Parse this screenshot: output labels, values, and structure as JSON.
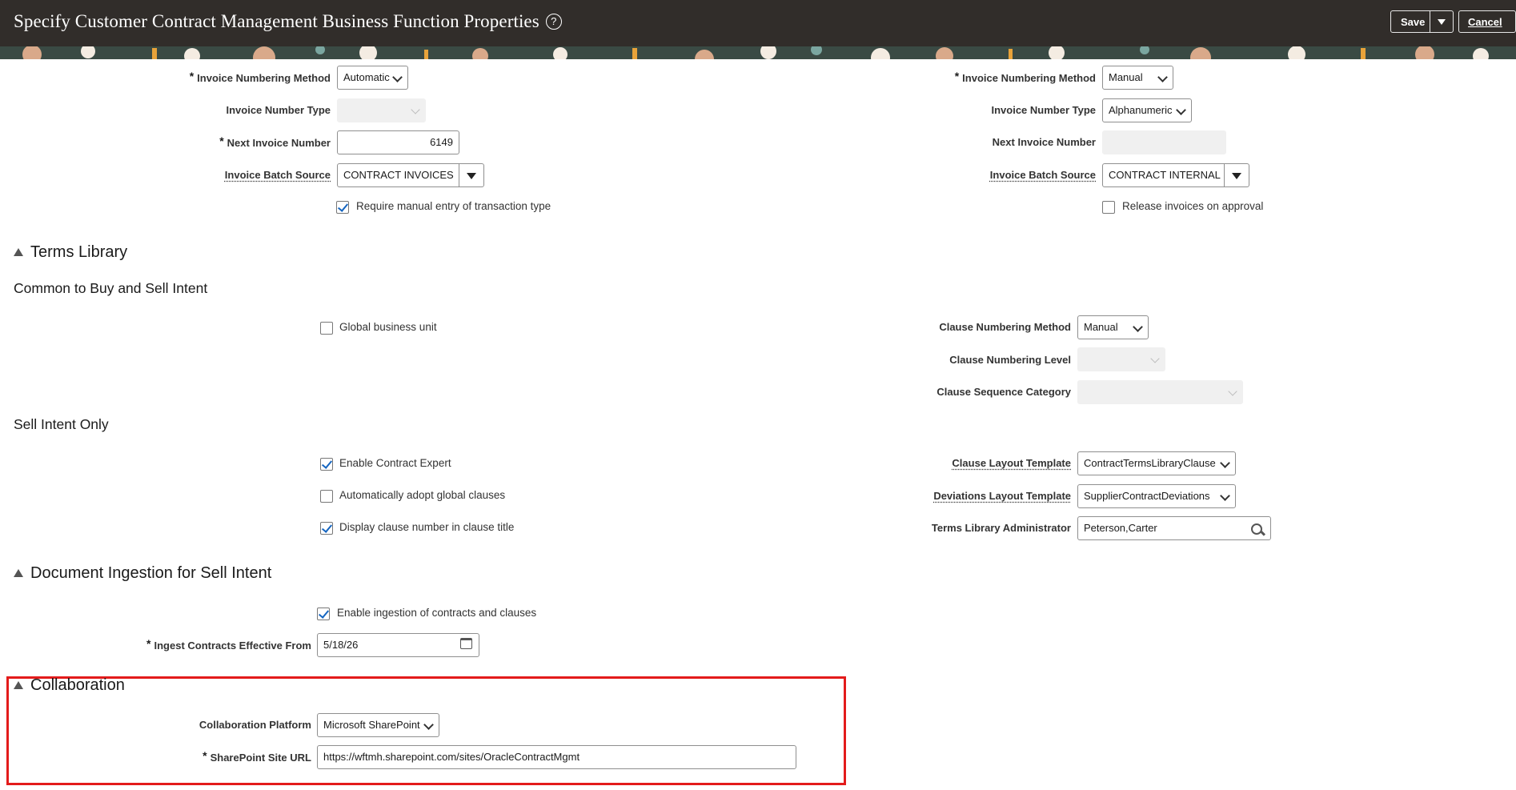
{
  "header": {
    "title": "Specify Customer Contract Management Business Function Properties",
    "help_icon": "?",
    "save_label": "Save",
    "cancel_label": "Cancel"
  },
  "invoice_left": {
    "numbering_method_label": "Invoice Numbering Method",
    "numbering_method_value": "Automatic",
    "number_type_label": "Invoice Number Type",
    "number_type_value": "",
    "next_number_label": "Next Invoice Number",
    "next_number_value": "6149",
    "batch_source_label": "Invoice Batch Source",
    "batch_source_value": "CONTRACT INVOICES",
    "manual_entry_label": "Require manual entry of transaction type",
    "manual_entry_checked": true
  },
  "invoice_right": {
    "numbering_method_label": "Invoice Numbering Method",
    "numbering_method_value": "Manual",
    "number_type_label": "Invoice Number Type",
    "number_type_value": "Alphanumeric",
    "next_number_label": "Next Invoice Number",
    "next_number_value": "",
    "batch_source_label": "Invoice Batch Source",
    "batch_source_value": "CONTRACT INTERNAL",
    "release_label": "Release invoices on approval",
    "release_checked": false
  },
  "terms_library": {
    "title": "Terms Library",
    "common_subtitle": "Common to Buy and Sell Intent",
    "global_bu_label": "Global business unit",
    "global_bu_checked": false,
    "clause_numbering_method_label": "Clause Numbering Method",
    "clause_numbering_method_value": "Manual",
    "clause_numbering_level_label": "Clause Numbering Level",
    "clause_numbering_level_value": "",
    "clause_sequence_category_label": "Clause Sequence Category",
    "clause_sequence_category_value": "",
    "sell_subtitle": "Sell Intent Only",
    "enable_expert_label": "Enable Contract Expert",
    "enable_expert_checked": true,
    "auto_adopt_label": "Automatically adopt global clauses",
    "auto_adopt_checked": false,
    "display_clause_number_label": "Display clause number in clause title",
    "display_clause_number_checked": true,
    "clause_layout_label": "Clause Layout Template",
    "clause_layout_value": "ContractTermsLibraryClause",
    "deviations_layout_label": "Deviations Layout Template",
    "deviations_layout_value": "SupplierContractDeviations",
    "admin_label": "Terms Library Administrator",
    "admin_value": "Peterson,Carter"
  },
  "document_ingestion": {
    "title": "Document Ingestion for Sell Intent",
    "enable_label": "Enable ingestion of contracts and clauses",
    "enable_checked": true,
    "effective_from_label": "Ingest Contracts Effective From",
    "effective_from_value": "5/18/26"
  },
  "collaboration": {
    "title": "Collaboration",
    "platform_label": "Collaboration Platform",
    "platform_value": "Microsoft SharePoint",
    "site_url_label": "SharePoint Site URL",
    "site_url_value": "https://wftmh.sharepoint.com/sites/OracleContractMgmt"
  },
  "colors": {
    "header_bg": "#312d2a",
    "highlight_border": "#e31b1b",
    "checkbox_check": "#1565c0"
  }
}
